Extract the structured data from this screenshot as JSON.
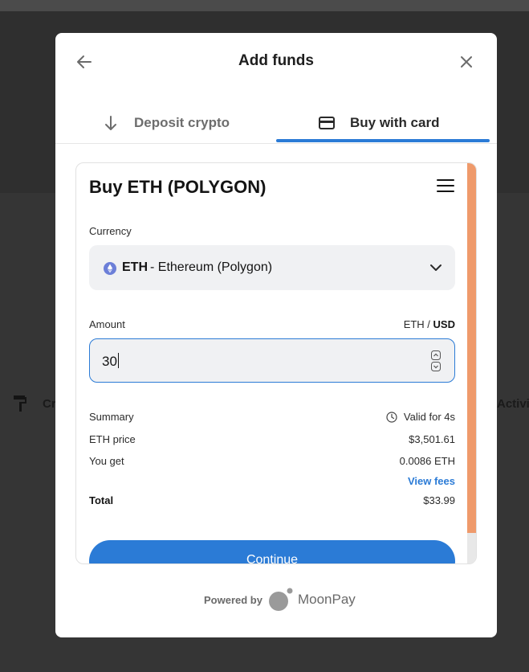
{
  "background": {
    "left_text": "Cr",
    "right_text": "Activi"
  },
  "modal": {
    "title": "Add funds",
    "tabs": [
      {
        "label": "Deposit crypto",
        "icon": "arrow-down-icon",
        "active": false
      },
      {
        "label": "Buy with card",
        "icon": "credit-card-icon",
        "active": true
      }
    ]
  },
  "widget": {
    "title": "Buy ETH (POLYGON)",
    "currency": {
      "label": "Currency",
      "code": "ETH",
      "name": "- Ethereum (Polygon)"
    },
    "amount": {
      "label": "Amount",
      "unit_secondary": "ETH /",
      "unit_primary": "USD",
      "value": "30"
    },
    "summary": {
      "label": "Summary",
      "valid_for": "Valid for 4s",
      "eth_price_label": "ETH price",
      "eth_price_value": "$3,501.61",
      "you_get_label": "You get",
      "you_get_value": "0.0086 ETH",
      "view_fees": "View fees",
      "total_label": "Total",
      "total_value": "$33.99"
    },
    "continue_label": "Continue"
  },
  "footer": {
    "powered_by": "Powered by",
    "brand": "MoonPay"
  },
  "colors": {
    "accent": "#2b7bd6",
    "scroll_thumb": "#ef9a6b"
  }
}
